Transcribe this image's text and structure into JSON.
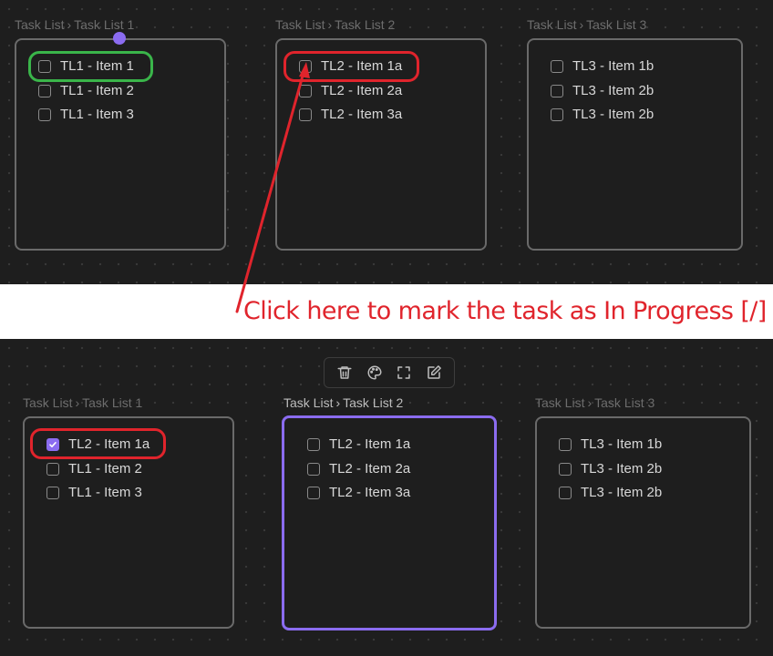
{
  "top": {
    "cards": [
      {
        "breadcrumb": [
          "Task List",
          "Task List 1"
        ],
        "items": [
          {
            "label": "TL1 - Item 1",
            "checked": false
          },
          {
            "label": "TL1 - Item 2",
            "checked": false
          },
          {
            "label": "TL1 - Item 3",
            "checked": false
          }
        ]
      },
      {
        "breadcrumb": [
          "Task List",
          "Task List 2"
        ],
        "items": [
          {
            "label": "TL2 - Item 1a",
            "checked": false
          },
          {
            "label": "TL2 - Item 2a",
            "checked": false
          },
          {
            "label": "TL2 - Item 3a",
            "checked": false
          }
        ]
      },
      {
        "breadcrumb": [
          "Task List",
          "Task List 3"
        ],
        "items": [
          {
            "label": "TL3 - Item 1b",
            "checked": false
          },
          {
            "label": "TL3 - Item 2b",
            "checked": false
          },
          {
            "label": "TL3 - Item 2b",
            "checked": false
          }
        ]
      }
    ]
  },
  "banner": {
    "text": "Click here to mark the task as In Progress [/]"
  },
  "bottom": {
    "toolbar": [
      "trash-icon",
      "palette-icon",
      "fullscreen-icon",
      "edit-icon"
    ],
    "cards": [
      {
        "breadcrumb": [
          "Task List",
          "Task List 1"
        ],
        "items": [
          {
            "label": "TL2 - Item 1a",
            "checked": true
          },
          {
            "label": "TL1 - Item 2",
            "checked": false
          },
          {
            "label": "TL1 - Item 3",
            "checked": false
          }
        ]
      },
      {
        "breadcrumb": [
          "Task List",
          "Task List 2"
        ],
        "items": [
          {
            "label": "TL2 - Item 1a",
            "checked": false
          },
          {
            "label": "TL2 - Item 2a",
            "checked": false
          },
          {
            "label": "TL2 - Item 3a",
            "checked": false
          }
        ]
      },
      {
        "breadcrumb": [
          "Task List",
          "Task List 3"
        ],
        "items": [
          {
            "label": "TL3 - Item 1b",
            "checked": false
          },
          {
            "label": "TL3 - Item 2b",
            "checked": false
          },
          {
            "label": "TL3 - Item 2b",
            "checked": false
          }
        ]
      }
    ]
  },
  "colors": {
    "accent": "#8b6cf0",
    "annotation_red": "#e0242c",
    "annotation_green": "#3ab54a"
  }
}
